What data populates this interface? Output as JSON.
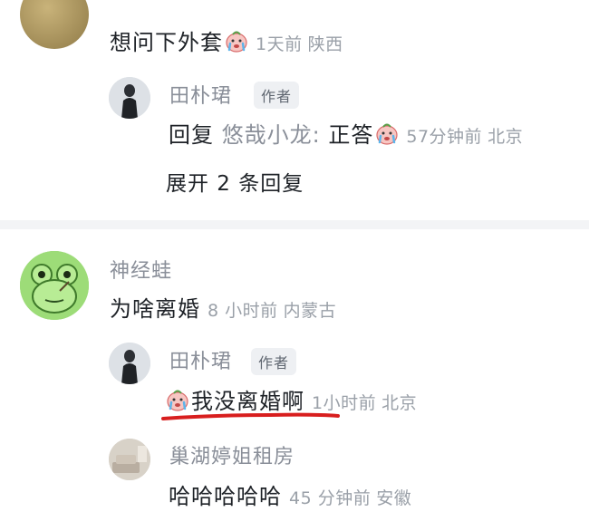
{
  "comments": [
    {
      "text": "想问下外套",
      "emoji_icon": "crying-face-icon",
      "time": "1天前",
      "location": "陕西",
      "replies": [
        {
          "name": "田朴珺",
          "badge": "作者",
          "reply_prefix": "回复",
          "reply_to": "悠哉小龙:",
          "text": "正答",
          "emoji_icon": "crying-face-icon",
          "time": "57分钟前",
          "location": "北京"
        }
      ],
      "expand_label": "展开 2 条回复"
    },
    {
      "name": "神经蛙",
      "avatar_icon": "frog-avatar-icon",
      "text": "为啥离婚",
      "time": "8 小时前",
      "location": "内蒙古",
      "replies": [
        {
          "name": "田朴珺",
          "badge": "作者",
          "emoji_icon": "crying-face-icon",
          "text": "我没离婚啊",
          "time": "1小时前",
          "location": "北京",
          "highlight_color": "#d81e1e"
        },
        {
          "name": "巢湖婷姐租房",
          "text": "哈哈哈哈哈",
          "time": "45 分钟前",
          "location": "安徽"
        }
      ]
    }
  ]
}
